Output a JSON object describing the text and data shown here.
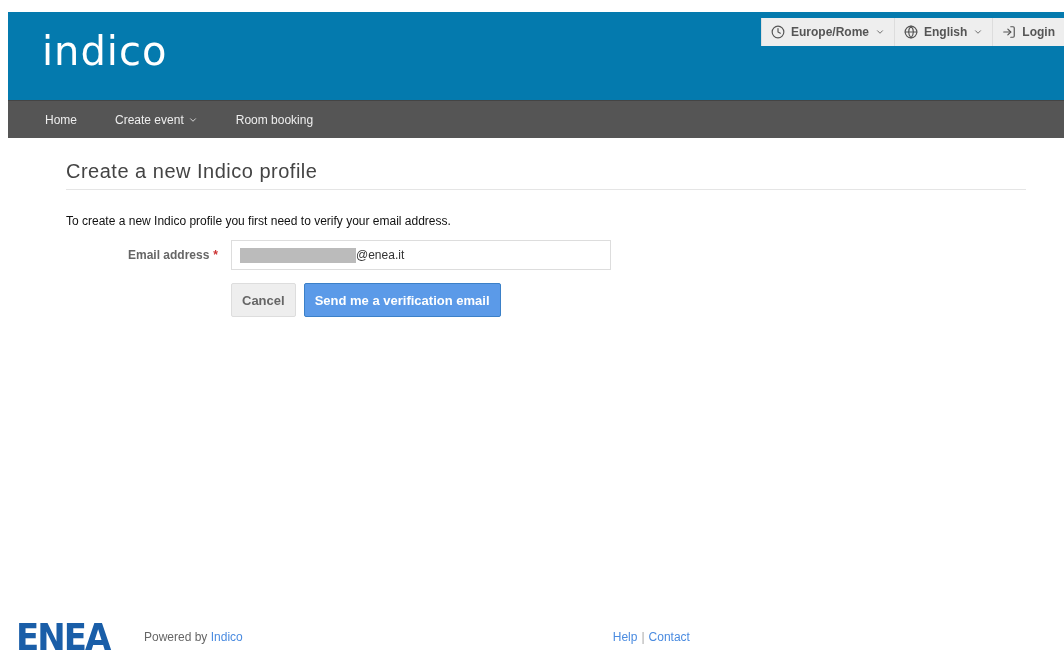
{
  "header": {
    "logo": "indico",
    "tools": [
      {
        "kind": "timezone",
        "label": "Europe/Rome"
      },
      {
        "kind": "language",
        "label": "English"
      },
      {
        "kind": "login",
        "label": "Login"
      }
    ]
  },
  "nav": [
    {
      "label": "Home",
      "dropdown": false
    },
    {
      "label": "Create event",
      "dropdown": true
    },
    {
      "label": "Room booking",
      "dropdown": false
    }
  ],
  "page": {
    "title": "Create a new Indico profile",
    "intro": "To create a new Indico profile you first need to verify your email address.",
    "field": {
      "label": "Email address",
      "required_mark": "*",
      "value": "@enea.it"
    },
    "buttons": [
      {
        "kind": "secondary",
        "label": "Cancel"
      },
      {
        "kind": "primary",
        "label": "Send me a verification email"
      }
    ]
  },
  "footer": {
    "logo": "ENEA",
    "powered": "Powered by",
    "powered_link": "Indico",
    "links": [
      "Help",
      "Contact"
    ],
    "separator": "|"
  }
}
